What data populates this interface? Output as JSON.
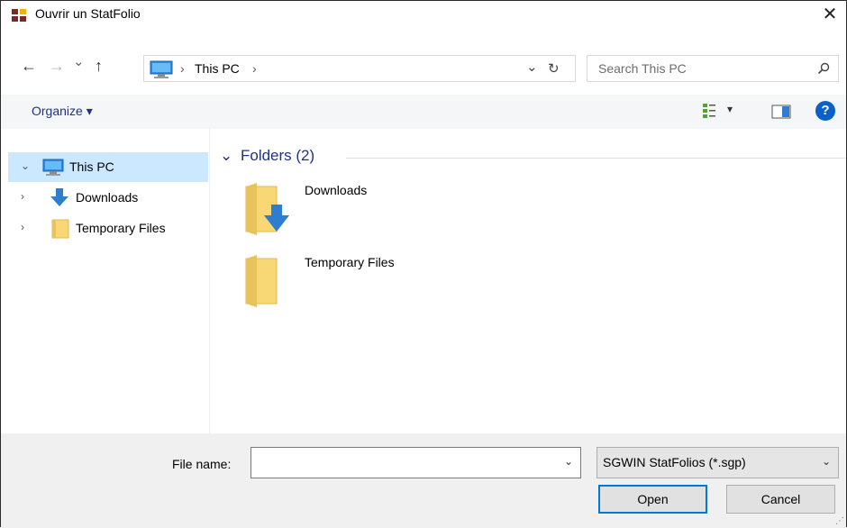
{
  "window": {
    "title": "Ouvrir un StatFolio",
    "close_glyph": "✕"
  },
  "navigation": {
    "back_glyph": "←",
    "forward_glyph": "→",
    "recent_glyph": "⌄",
    "up_glyph": "↑"
  },
  "address": {
    "crumbs": [
      "This PC"
    ],
    "separator": "›",
    "dropdown_glyph": "⌄",
    "refresh_glyph": "↻"
  },
  "search": {
    "placeholder": "Search This PC",
    "icon_glyph": "⚲"
  },
  "toolbar": {
    "organize_label": "Organize ▾",
    "view_dropdown_glyph": "▾",
    "help_glyph": "?"
  },
  "nav_pane": {
    "items": [
      {
        "label": "This PC",
        "chevron": "⌄",
        "icon": "computer-icon",
        "selected": true
      },
      {
        "label": "Downloads",
        "chevron": "›",
        "icon": "download-arrow-icon",
        "selected": false
      },
      {
        "label": "Temporary Files",
        "chevron": "›",
        "icon": "folder-icon",
        "selected": false
      }
    ]
  },
  "content": {
    "group_title": "Folders (2)",
    "group_chevron": "⌄",
    "folders": [
      {
        "name": "Downloads",
        "icon": "downloads-folder-icon"
      },
      {
        "name": "Temporary Files",
        "icon": "folder-icon"
      }
    ]
  },
  "footer": {
    "file_name_label": "File name:",
    "file_name_value": "",
    "filter_value": "SGWIN StatFolios (*.sgp)",
    "dropdown_glyph": "⌄",
    "open_label": "Open",
    "cancel_label": "Cancel"
  },
  "colors": {
    "accent_blue": "#0078d7",
    "link_blue": "#1e3287",
    "selection": "#cce8ff",
    "folder_yellow": "#f8d775",
    "footer_bg": "#f0f0f0"
  }
}
